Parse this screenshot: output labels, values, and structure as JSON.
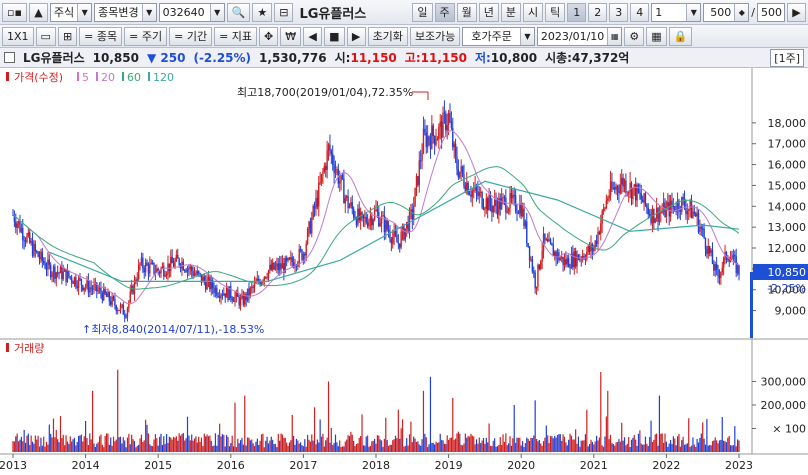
{
  "toolbar1": {
    "market": "주식",
    "code_change_label": "종목변경",
    "code": "032640",
    "stock_name": "LG유플러스",
    "periods": [
      "일",
      "주",
      "월",
      "년",
      "분",
      "시",
      "틱"
    ],
    "selected_period": "주",
    "ticks_nums": [
      "1",
      "2",
      "3",
      "4"
    ],
    "interval_value": "1",
    "count_value": "500",
    "count_total": "500",
    "slash": "/"
  },
  "toolbar2": {
    "ratio": "1X1",
    "items": [
      "= 종목",
      "= 주기",
      "= 기간",
      "= 지표"
    ],
    "won_label": "₩",
    "reset_label": "초기화",
    "aux_label": "보조가능",
    "order_label": "호가주문",
    "date": "2023/01/10"
  },
  "info": {
    "name": "LG유플러스",
    "price": "10,850",
    "change": "▼ 250",
    "change_pct": "(-2.25%)",
    "volume": "1,530,776",
    "open_label": "시:",
    "open": "11,150",
    "high_label": "고:",
    "high": "11,150",
    "low_label": "저:",
    "low": "10,800",
    "cap_label": "시총:",
    "cap": "47,372억",
    "unit_label": "[1주]"
  },
  "chart_data": {
    "type": "candlestick",
    "x_ticks": [
      "2013",
      "2014",
      "2015",
      "2016",
      "2017",
      "2018",
      "2019",
      "2020",
      "2021",
      "2022",
      "2023"
    ],
    "price_panel": {
      "legend": [
        {
          "label": "가격(수정)",
          "color": "#d11f1f"
        },
        {
          "label": "5",
          "color": "#e06ec0"
        },
        {
          "label": "20",
          "color": "#c07ad0"
        },
        {
          "label": "60",
          "color": "#3aa87a"
        },
        {
          "label": "120",
          "color": "#3aa8a8"
        }
      ],
      "y_ticks": [
        9000,
        10000,
        11000,
        12000,
        13000,
        14000,
        15000,
        16000,
        17000,
        18000
      ],
      "y_tick_labels": [
        "9,000",
        "10,000",
        "11,000",
        "12,000",
        "13,000",
        "14,000",
        "15,000",
        "16,000",
        "17,000",
        "18,000"
      ],
      "ylim": [
        8300,
        19800
      ],
      "current_price": 10850,
      "current_price_label": "10,850",
      "current_change_label": "-2.25%",
      "annotations": [
        {
          "text": "최고18,700(2019/01/04),72.35%",
          "value": 18700
        },
        {
          "text": "최저8,840(2014/07/11),-18.53%",
          "value": 8840
        }
      ],
      "close_series": [
        {
          "year": 2013.0,
          "value": 13600
        },
        {
          "year": 2013.3,
          "value": 11800
        },
        {
          "year": 2013.5,
          "value": 11000
        },
        {
          "year": 2013.8,
          "value": 10600
        },
        {
          "year": 2014.0,
          "value": 10200
        },
        {
          "year": 2014.2,
          "value": 9900
        },
        {
          "year": 2014.4,
          "value": 9300
        },
        {
          "year": 2014.55,
          "value": 8900
        },
        {
          "year": 2014.75,
          "value": 11200
        },
        {
          "year": 2015.0,
          "value": 10900
        },
        {
          "year": 2015.3,
          "value": 11400
        },
        {
          "year": 2015.6,
          "value": 10500
        },
        {
          "year": 2015.8,
          "value": 10000
        },
        {
          "year": 2016.0,
          "value": 9800
        },
        {
          "year": 2016.15,
          "value": 9400
        },
        {
          "year": 2016.5,
          "value": 10900
        },
        {
          "year": 2016.8,
          "value": 11200
        },
        {
          "year": 2017.0,
          "value": 11800
        },
        {
          "year": 2017.2,
          "value": 14500
        },
        {
          "year": 2017.35,
          "value": 16800
        },
        {
          "year": 2017.6,
          "value": 14200
        },
        {
          "year": 2017.8,
          "value": 13200
        },
        {
          "year": 2018.0,
          "value": 13700
        },
        {
          "year": 2018.3,
          "value": 12200
        },
        {
          "year": 2018.5,
          "value": 13600
        },
        {
          "year": 2018.65,
          "value": 17200
        },
        {
          "year": 2018.85,
          "value": 17500
        },
        {
          "year": 2019.0,
          "value": 18300
        },
        {
          "year": 2019.1,
          "value": 16000
        },
        {
          "year": 2019.3,
          "value": 14800
        },
        {
          "year": 2019.6,
          "value": 14000
        },
        {
          "year": 2019.8,
          "value": 14200
        },
        {
          "year": 2020.0,
          "value": 14000
        },
        {
          "year": 2020.2,
          "value": 10200
        },
        {
          "year": 2020.3,
          "value": 12300
        },
        {
          "year": 2020.6,
          "value": 11300
        },
        {
          "year": 2020.8,
          "value": 11600
        },
        {
          "year": 2021.0,
          "value": 12000
        },
        {
          "year": 2021.2,
          "value": 14600
        },
        {
          "year": 2021.4,
          "value": 15200
        },
        {
          "year": 2021.6,
          "value": 14600
        },
        {
          "year": 2021.8,
          "value": 13600
        },
        {
          "year": 2022.0,
          "value": 13800
        },
        {
          "year": 2022.2,
          "value": 14200
        },
        {
          "year": 2022.4,
          "value": 13600
        },
        {
          "year": 2022.55,
          "value": 12200
        },
        {
          "year": 2022.7,
          "value": 10600
        },
        {
          "year": 2022.85,
          "value": 11800
        },
        {
          "year": 2023.0,
          "value": 10850
        }
      ],
      "ma120_series": [
        {
          "year": 2013.5,
          "value": 11800
        },
        {
          "year": 2014.5,
          "value": 10400
        },
        {
          "year": 2015.5,
          "value": 10400
        },
        {
          "year": 2016.5,
          "value": 10400
        },
        {
          "year": 2017.5,
          "value": 11400
        },
        {
          "year": 2018.5,
          "value": 13300
        },
        {
          "year": 2019.5,
          "value": 15200
        },
        {
          "year": 2020.5,
          "value": 14300
        },
        {
          "year": 2021.5,
          "value": 12800
        },
        {
          "year": 2022.5,
          "value": 13100
        },
        {
          "year": 2023.0,
          "value": 12900
        }
      ]
    },
    "volume_panel": {
      "legend": "거래량",
      "y_ticks": [
        100000,
        200000,
        300000
      ],
      "y_tick_labels": [
        "× 100",
        "200,000",
        "300,000"
      ],
      "ylim": [
        0,
        370000
      ],
      "spikes": [
        {
          "year": 2014.1,
          "value": 260000
        },
        {
          "year": 2014.45,
          "value": 350000
        },
        {
          "year": 2015.4,
          "value": 150000
        },
        {
          "year": 2016.05,
          "value": 210000
        },
        {
          "year": 2016.2,
          "value": 240000
        },
        {
          "year": 2017.15,
          "value": 190000
        },
        {
          "year": 2017.35,
          "value": 300000
        },
        {
          "year": 2017.8,
          "value": 160000
        },
        {
          "year": 2018.3,
          "value": 180000
        },
        {
          "year": 2018.65,
          "value": 260000
        },
        {
          "year": 2018.75,
          "value": 320000
        },
        {
          "year": 2019.05,
          "value": 230000
        },
        {
          "year": 2019.9,
          "value": 200000
        },
        {
          "year": 2020.2,
          "value": 220000
        },
        {
          "year": 2020.9,
          "value": 180000
        },
        {
          "year": 2021.1,
          "value": 340000
        },
        {
          "year": 2021.2,
          "value": 260000
        },
        {
          "year": 2021.9,
          "value": 240000
        },
        {
          "year": 2022.55,
          "value": 140000
        },
        {
          "year": 2022.95,
          "value": 110000
        }
      ]
    }
  }
}
